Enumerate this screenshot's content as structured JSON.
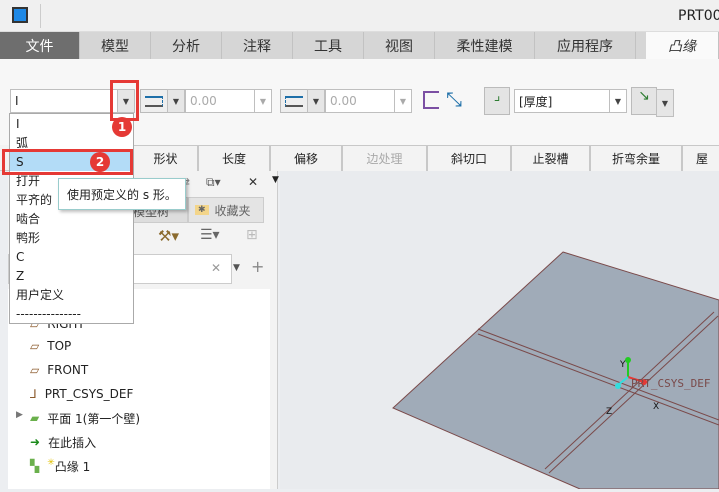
{
  "title_bar": {
    "doc_title": "PRT00"
  },
  "ribbon_tabs": [
    {
      "label": "文件"
    },
    {
      "label": "模型"
    },
    {
      "label": "分析"
    },
    {
      "label": "注释"
    },
    {
      "label": "工具"
    },
    {
      "label": "视图"
    },
    {
      "label": "柔性建模"
    },
    {
      "label": "应用程序"
    },
    {
      "label": "凸缘"
    }
  ],
  "toolbar": {
    "shape_value": "I",
    "length1_value": "0.00",
    "length2_value": "0.00",
    "thickness_value": "[厚度]"
  },
  "sub_tabs": [
    {
      "label": "形状"
    },
    {
      "label": "长度"
    },
    {
      "label": "偏移"
    },
    {
      "label": "边处理",
      "disabled": true
    },
    {
      "label": "斜切口"
    },
    {
      "label": "止裂槽"
    },
    {
      "label": "折弯余量"
    },
    {
      "label": "屋"
    }
  ],
  "shape_dropdown": {
    "options": [
      "I",
      "弧",
      "S",
      "打开",
      "平齐的",
      "啮合",
      "鸭形",
      "C",
      "Z",
      "用户定义",
      "---------------"
    ],
    "selected": "S"
  },
  "tooltip": "使用预定义的 s 形。",
  "annotations": {
    "badge1": "1",
    "badge2": "2",
    "color": "#e53935"
  },
  "model_tree": {
    "tabs": [
      {
        "label": "模型树"
      },
      {
        "label": "收藏夹"
      }
    ],
    "search_placeholder": "",
    "items": [
      {
        "label": "RIGHT",
        "icon": "datum-plane-icon"
      },
      {
        "label": "TOP",
        "icon": "datum-plane-icon"
      },
      {
        "label": "FRONT",
        "icon": "datum-plane-icon"
      },
      {
        "label": "PRT_CSYS_DEF",
        "icon": "csys-icon"
      },
      {
        "label": "平面 1(第一个壁)",
        "icon": "sheetmetal-wall-icon"
      },
      {
        "label": "在此插入",
        "icon": "insert-arrow-icon"
      },
      {
        "label": "凸缘 1",
        "icon": "flange-icon"
      }
    ]
  },
  "viewport": {
    "csys_label": "PRT_CSYS_DEF",
    "axis_x": "X",
    "axis_y": "Y",
    "axis_z": "Z",
    "plate_color": "#a0abb8"
  }
}
